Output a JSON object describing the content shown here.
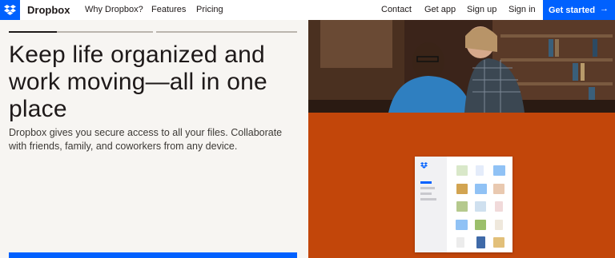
{
  "nav": {
    "brand": "Dropbox",
    "links": [
      "Why Dropbox?",
      "Features",
      "Pricing"
    ],
    "right_links": [
      "Contact",
      "Get app",
      "Sign up",
      "Sign in"
    ],
    "cta": "Get started",
    "cta_arrow": "→"
  },
  "hero": {
    "headline": "Keep life organized and work moving—all in one place",
    "subtext": "Dropbox gives you secure access to all your files. Collaborate with friends, family, and coworkers from any device.",
    "progress": [
      1,
      0,
      0,
      0
    ],
    "progress_fill": [
      0.5,
      0,
      0,
      0
    ]
  },
  "colors": {
    "brand_blue": "#0061fe",
    "hero_bg": "#f7f5f2",
    "orange": "#c2460a"
  },
  "icons": [
    "dropbox-logo-icon",
    "arrow-right-icon"
  ]
}
